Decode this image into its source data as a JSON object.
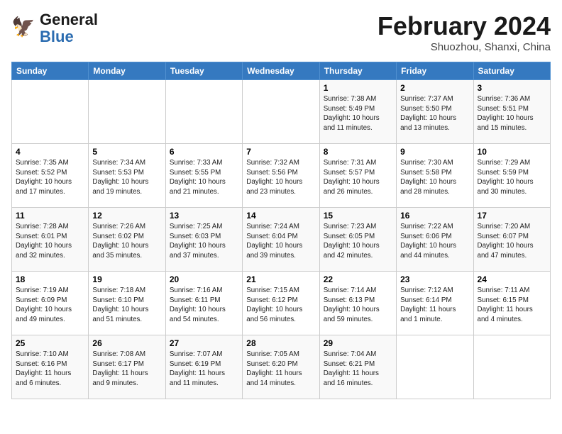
{
  "header": {
    "logo_line1": "General",
    "logo_line2": "Blue",
    "month": "February 2024",
    "location": "Shuozhou, Shanxi, China"
  },
  "weekdays": [
    "Sunday",
    "Monday",
    "Tuesday",
    "Wednesday",
    "Thursday",
    "Friday",
    "Saturday"
  ],
  "weeks": [
    [
      {
        "day": "",
        "info": ""
      },
      {
        "day": "",
        "info": ""
      },
      {
        "day": "",
        "info": ""
      },
      {
        "day": "",
        "info": ""
      },
      {
        "day": "1",
        "info": "Sunrise: 7:38 AM\nSunset: 5:49 PM\nDaylight: 10 hours\nand 11 minutes."
      },
      {
        "day": "2",
        "info": "Sunrise: 7:37 AM\nSunset: 5:50 PM\nDaylight: 10 hours\nand 13 minutes."
      },
      {
        "day": "3",
        "info": "Sunrise: 7:36 AM\nSunset: 5:51 PM\nDaylight: 10 hours\nand 15 minutes."
      }
    ],
    [
      {
        "day": "4",
        "info": "Sunrise: 7:35 AM\nSunset: 5:52 PM\nDaylight: 10 hours\nand 17 minutes."
      },
      {
        "day": "5",
        "info": "Sunrise: 7:34 AM\nSunset: 5:53 PM\nDaylight: 10 hours\nand 19 minutes."
      },
      {
        "day": "6",
        "info": "Sunrise: 7:33 AM\nSunset: 5:55 PM\nDaylight: 10 hours\nand 21 minutes."
      },
      {
        "day": "7",
        "info": "Sunrise: 7:32 AM\nSunset: 5:56 PM\nDaylight: 10 hours\nand 23 minutes."
      },
      {
        "day": "8",
        "info": "Sunrise: 7:31 AM\nSunset: 5:57 PM\nDaylight: 10 hours\nand 26 minutes."
      },
      {
        "day": "9",
        "info": "Sunrise: 7:30 AM\nSunset: 5:58 PM\nDaylight: 10 hours\nand 28 minutes."
      },
      {
        "day": "10",
        "info": "Sunrise: 7:29 AM\nSunset: 5:59 PM\nDaylight: 10 hours\nand 30 minutes."
      }
    ],
    [
      {
        "day": "11",
        "info": "Sunrise: 7:28 AM\nSunset: 6:01 PM\nDaylight: 10 hours\nand 32 minutes."
      },
      {
        "day": "12",
        "info": "Sunrise: 7:26 AM\nSunset: 6:02 PM\nDaylight: 10 hours\nand 35 minutes."
      },
      {
        "day": "13",
        "info": "Sunrise: 7:25 AM\nSunset: 6:03 PM\nDaylight: 10 hours\nand 37 minutes."
      },
      {
        "day": "14",
        "info": "Sunrise: 7:24 AM\nSunset: 6:04 PM\nDaylight: 10 hours\nand 39 minutes."
      },
      {
        "day": "15",
        "info": "Sunrise: 7:23 AM\nSunset: 6:05 PM\nDaylight: 10 hours\nand 42 minutes."
      },
      {
        "day": "16",
        "info": "Sunrise: 7:22 AM\nSunset: 6:06 PM\nDaylight: 10 hours\nand 44 minutes."
      },
      {
        "day": "17",
        "info": "Sunrise: 7:20 AM\nSunset: 6:07 PM\nDaylight: 10 hours\nand 47 minutes."
      }
    ],
    [
      {
        "day": "18",
        "info": "Sunrise: 7:19 AM\nSunset: 6:09 PM\nDaylight: 10 hours\nand 49 minutes."
      },
      {
        "day": "19",
        "info": "Sunrise: 7:18 AM\nSunset: 6:10 PM\nDaylight: 10 hours\nand 51 minutes."
      },
      {
        "day": "20",
        "info": "Sunrise: 7:16 AM\nSunset: 6:11 PM\nDaylight: 10 hours\nand 54 minutes."
      },
      {
        "day": "21",
        "info": "Sunrise: 7:15 AM\nSunset: 6:12 PM\nDaylight: 10 hours\nand 56 minutes."
      },
      {
        "day": "22",
        "info": "Sunrise: 7:14 AM\nSunset: 6:13 PM\nDaylight: 10 hours\nand 59 minutes."
      },
      {
        "day": "23",
        "info": "Sunrise: 7:12 AM\nSunset: 6:14 PM\nDaylight: 11 hours\nand 1 minute."
      },
      {
        "day": "24",
        "info": "Sunrise: 7:11 AM\nSunset: 6:15 PM\nDaylight: 11 hours\nand 4 minutes."
      }
    ],
    [
      {
        "day": "25",
        "info": "Sunrise: 7:10 AM\nSunset: 6:16 PM\nDaylight: 11 hours\nand 6 minutes."
      },
      {
        "day": "26",
        "info": "Sunrise: 7:08 AM\nSunset: 6:17 PM\nDaylight: 11 hours\nand 9 minutes."
      },
      {
        "day": "27",
        "info": "Sunrise: 7:07 AM\nSunset: 6:19 PM\nDaylight: 11 hours\nand 11 minutes."
      },
      {
        "day": "28",
        "info": "Sunrise: 7:05 AM\nSunset: 6:20 PM\nDaylight: 11 hours\nand 14 minutes."
      },
      {
        "day": "29",
        "info": "Sunrise: 7:04 AM\nSunset: 6:21 PM\nDaylight: 11 hours\nand 16 minutes."
      },
      {
        "day": "",
        "info": ""
      },
      {
        "day": "",
        "info": ""
      }
    ]
  ]
}
